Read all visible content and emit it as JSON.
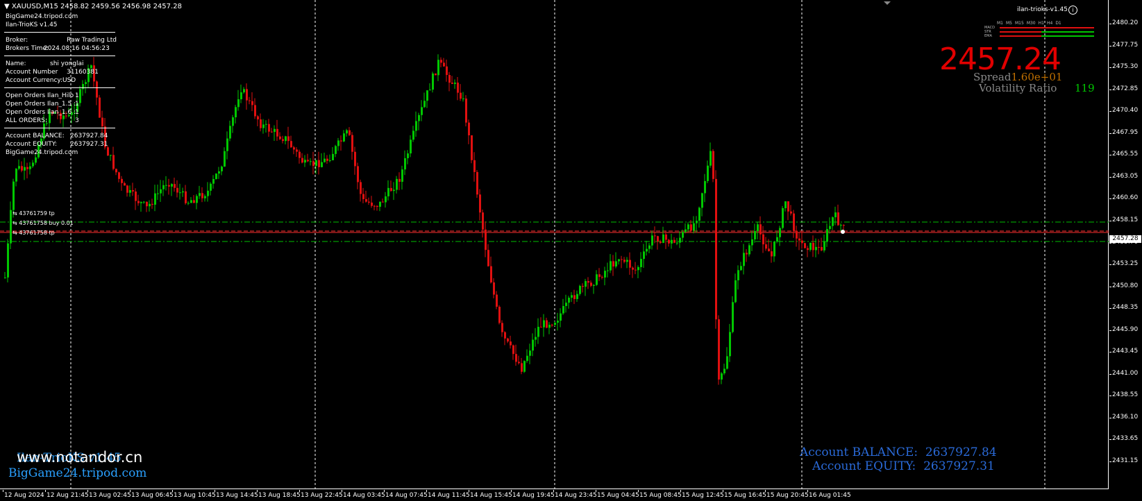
{
  "window": {
    "symbol_line": "XAUUSD,M15  2458.82 2459.56 2456.98 2457.28",
    "indicator_name": "ilan-trioks-v1.45",
    "info_icon": "i"
  },
  "info_panel": {
    "site": "BigGame24.tripod.com",
    "ea_name": "Ilan-TrioKS v1.45",
    "broker_label": "Broker:",
    "broker_value": "Raw Trading Ltd",
    "broker_time_label": "Brokers Time:",
    "broker_time_value": "2024.08.16 04:56:23",
    "name_label": "Name:",
    "name_value": "shi yonglai",
    "account_number_label": "Account Number",
    "account_number_value": "31160381",
    "account_currency_label": "Account Currency:",
    "account_currency_value": "USD",
    "open_orders": [
      {
        "label": "Open Orders Ilan_Hilo :",
        "value": "1"
      },
      {
        "label": "Open Orders Ilan_1.5 :",
        "value": "1"
      },
      {
        "label": "Open Orders Ilan_1.6 :",
        "value": "1"
      },
      {
        "label": "ALL ORDERS:",
        "value": "3"
      }
    ],
    "balance_label": "Account BALANCE:",
    "balance_value": "2637927.84",
    "equity_label": "Account EQUITY:",
    "equity_value": "2637927.31",
    "site_footer": "BigGame24.tripod.com"
  },
  "indicator": {
    "timeframes": [
      "M1",
      "M5",
      "M15",
      "M30",
      "H1",
      "H4",
      "D1"
    ],
    "rows": [
      "MACD",
      "STR",
      "EMA"
    ],
    "big_price": "2457.24",
    "spread_label": "Spread",
    "spread_value": "1.60e+01",
    "volatility_label": "Volatility Ratio",
    "volatility_value": "119"
  },
  "price_axis": {
    "labels": [
      "2480.20",
      "2477.75",
      "2475.30",
      "2472.85",
      "2470.40",
      "2467.95",
      "2465.55",
      "2463.05",
      "2460.60",
      "2458.15",
      "2455.70",
      "2453.25",
      "2450.80",
      "2448.35",
      "2445.90",
      "2443.45",
      "2441.00",
      "2438.55",
      "2436.10",
      "2433.65",
      "2431.15"
    ],
    "current_price": "2457.28"
  },
  "time_axis": {
    "labels": [
      "12 Aug 2024",
      "12 Aug 21:45",
      "13 Aug 02:45",
      "13 Aug 06:45",
      "13 Aug 10:45",
      "13 Aug 14:45",
      "13 Aug 18:45",
      "13 Aug 22:45",
      "14 Aug 03:45",
      "14 Aug 07:45",
      "14 Aug 11:45",
      "14 Aug 15:45",
      "14 Aug 19:45",
      "14 Aug 23:45",
      "15 Aug 04:45",
      "15 Aug 08:45",
      "15 Aug 12:45",
      "15 Aug 16:45",
      "15 Aug 20:45",
      "16 Aug 01:45"
    ]
  },
  "orders": {
    "tp_top": "43761759 tp",
    "buy_line": "43761758 buy 0.01",
    "tp_bottom": "43761758 tp"
  },
  "footer": {
    "watermark": "www.notandor.cn",
    "ea_title": "Ilan-TrioKS v1.45",
    "site": "BigGame24.tripod.com",
    "balance_label": "Account BALANCE:",
    "balance_value": "2637927.84",
    "equity_label": "Account EQUITY:",
    "equity_value": "2637927.31"
  },
  "colors": {
    "bull": "#00c800",
    "bear": "#e01010",
    "sell_line": "#ff3030",
    "tp_line": "#00c000",
    "grid": "#ffffff",
    "price_big": "#e00000"
  }
}
